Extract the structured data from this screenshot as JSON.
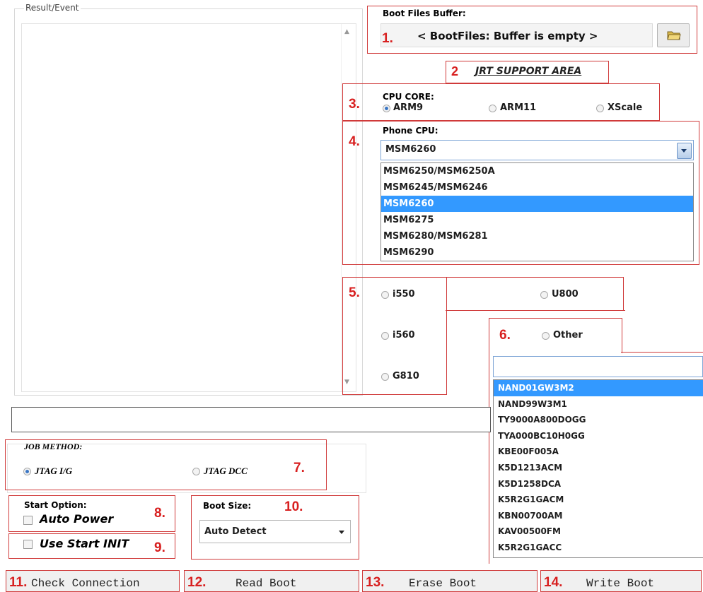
{
  "result": {
    "label": "Result/Event"
  },
  "boot_files": {
    "title": "Boot Files Buffer:",
    "status": "< BootFiles: Buffer is empty >",
    "number": "1."
  },
  "jrt": {
    "number": "2",
    "label": "JRT SUPPORT AREA"
  },
  "cpu_core": {
    "number": "3.",
    "title": "CPU CORE:",
    "options": [
      "ARM9",
      "ARM11",
      "XScale"
    ],
    "selected": "ARM9"
  },
  "phone_cpu": {
    "number": "4.",
    "title": "Phone CPU:",
    "selected": "MSM6260",
    "options": [
      "MSM6250/MSM6250A",
      "MSM6245/MSM6246",
      "MSM6260",
      "MSM6275",
      "MSM6280/MSM6281",
      "MSM6290"
    ]
  },
  "models": {
    "number": "5.",
    "options": [
      "i550",
      "U800",
      "i560",
      "G810"
    ]
  },
  "other": {
    "number": "6.",
    "label": "Other",
    "input_value": "",
    "nand_list": [
      "NAND01GW3M2",
      "NAND99W3M1",
      "TY9000A800DOGG",
      "TYA000BC10H0GG",
      "KBE00F005A",
      "K5D1213ACM",
      "K5D1258DCA",
      "K5R2G1GACM",
      "KBN00700AM",
      "KAV00500FM",
      "K5R2G1GACC"
    ],
    "selected": "NAND01GW3M2"
  },
  "job_method": {
    "number": "7.",
    "title": "JOB METHOD:",
    "options": [
      "JTAG I/G",
      "JTAG DCC"
    ],
    "selected": "JTAG I/G"
  },
  "start_option": {
    "number": "8.",
    "title": "Start Option:",
    "checkbox_label": "Auto Power"
  },
  "use_start": {
    "number": "9.",
    "checkbox_label": "Use Start INIT"
  },
  "boot_size": {
    "number": "10.",
    "title": "Boot Size:",
    "selected": "Auto Detect"
  },
  "buttons": [
    {
      "number": "11.",
      "label": "Check Connection"
    },
    {
      "number": "12.",
      "label": "Read Boot"
    },
    {
      "number": "13.",
      "label": "Erase Boot"
    },
    {
      "number": "14.",
      "label": "Write Boot"
    }
  ]
}
